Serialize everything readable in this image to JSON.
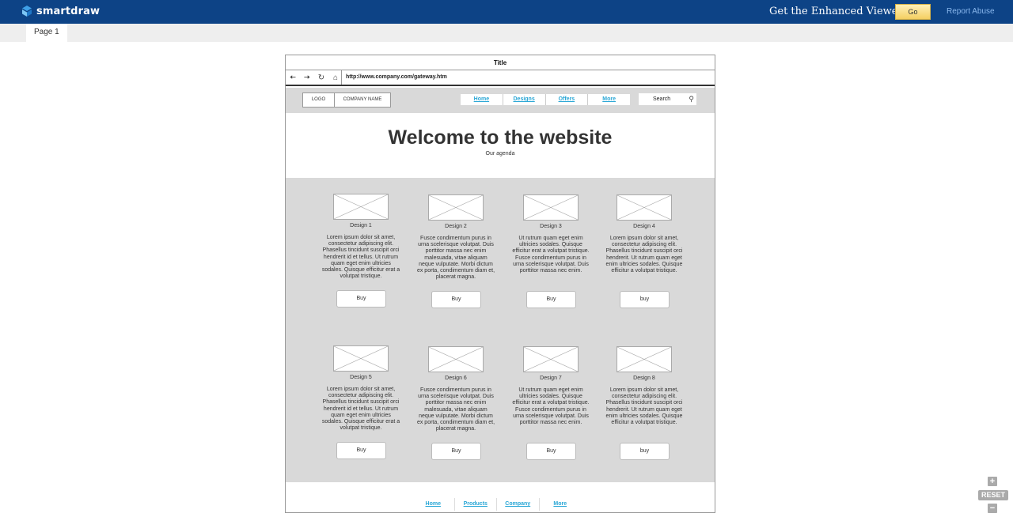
{
  "header": {
    "brand": "smartdraw",
    "enhanced_viewer": "Get the Enhanced Viewer",
    "go_label": "Go",
    "report_abuse": "Report Abuse"
  },
  "tabs": [
    "Page 1"
  ],
  "mockup": {
    "title": "Title",
    "url": "http://www.company.com/gateway.htm",
    "logo_label": "LOGO",
    "company_label": "COMPANY NAME",
    "top_nav": [
      "Home",
      "Designs",
      "Offers",
      "More"
    ],
    "search_label": "Search",
    "hero_title": "Welcome to the website",
    "hero_sub": "Our agenda",
    "cards": [
      {
        "title": "Design 1",
        "desc": "Lorem ipsum dolor sit amet, consectetur adipiscing elit. Phasellus tincidunt suscipit orci hendrerit id et tellus. Ut rutrum quam eget enim ultricies sodales. Quisque efficitur erat a volutpat tristique.",
        "buy": "Buy"
      },
      {
        "title": "Design 2",
        "desc": "Fusce condimentum purus in urna scelerisque volutpat. Duis porttitor massa nec enim malesuada, vitae aliquam neque vulputate. Morbi dictum ex porta, condimentum diam et, placerat magna.",
        "buy": "Buy"
      },
      {
        "title": "Design 3",
        "desc": "Ut rutrum quam eget enim ultricies sodales. Quisque efficitur erat a volutpat tristique. Fusce condimentum purus in urna scelerisque volutpat. Duis porttitor massa nec enim.",
        "buy": "Buy"
      },
      {
        "title": "Design 4",
        "desc": "Lorem ipsum dolor sit amet, consectetur adipiscing elit. Phasellus tincidunt suscipit orci hendrerit. Ut rutrum quam eget enim ultricies sodales. Quisque efficitur a volutpat tristique.",
        "buy": "buy"
      },
      {
        "title": "Design 5",
        "desc": "Lorem ipsum dolor sit amet, consectetur adipiscing elit. Phasellus tincidunt suscipit orci hendrerit id et tellus. Ut rutrum quam eget enim ultricies sodales. Quisque efficitur erat a volutpat tristique.",
        "buy": "Buy"
      },
      {
        "title": "Design 6",
        "desc": "Fusce condimentum purus in urna scelerisque volutpat. Duis porttitor massa nec enim malesuada, vitae aliquam neque vulputate. Morbi dictum ex porta, condimentum diam et, placerat magna.",
        "buy": "Buy"
      },
      {
        "title": "Design 7",
        "desc": "Ut rutrum quam eget enim ultricies sodales. Quisque efficitur erat a volutpat tristique. Fusce condimentum purus in urna scelerisque volutpat. Duis porttitor massa nec enim.",
        "buy": "Buy"
      },
      {
        "title": "Design 8",
        "desc": "Lorem ipsum dolor sit amet, consectetur adipiscing elit. Phasellus tincidunt suscipit orci hendrerit. Ut rutrum quam eget enim ultricies sodales. Quisque efficitur a volutpat tristique.",
        "buy": "buy"
      }
    ],
    "footer_nav": [
      "Home",
      "Products",
      "Company",
      "More"
    ]
  },
  "zoom": {
    "plus": "+",
    "reset": "RESET",
    "minus": "−"
  },
  "colors": {
    "topbar": "#0d4386",
    "link": "#2aa7d6",
    "gray_band": "#d9d9d9",
    "go_button": "#f5cf62"
  }
}
